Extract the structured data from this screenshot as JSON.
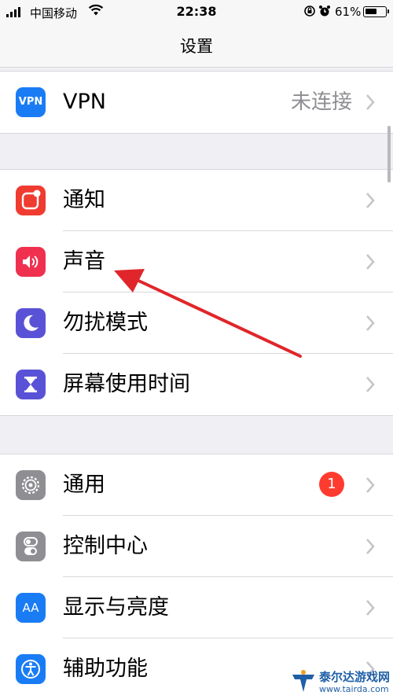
{
  "status_bar": {
    "carrier": "中国移动",
    "time": "22:38",
    "battery_percent": "61%",
    "battery_level": 0.61
  },
  "nav": {
    "title": "设置"
  },
  "groups": [
    {
      "rows": [
        {
          "label": "VPN",
          "detail": "未连接",
          "icon": "vpn-icon",
          "icon_text": "VPN",
          "icon_color": "#1a7cf5"
        }
      ]
    },
    {
      "rows": [
        {
          "label": "通知",
          "icon": "notifications-icon",
          "icon_color": "#f03b30"
        },
        {
          "label": "声音",
          "icon": "sounds-icon",
          "icon_color": "#f0304f"
        },
        {
          "label": "勿扰模式",
          "icon": "do-not-disturb-icon",
          "icon_color": "#5a52d6"
        },
        {
          "label": "屏幕使用时间",
          "icon": "screen-time-icon",
          "icon_color": "#5a52d6"
        }
      ]
    },
    {
      "rows": [
        {
          "label": "通用",
          "badge": "1",
          "icon": "general-icon",
          "icon_color": "#8e8e93"
        },
        {
          "label": "控制中心",
          "icon": "control-center-icon",
          "icon_color": "#8e8e93"
        },
        {
          "label": "显示与亮度",
          "icon": "display-icon",
          "icon_text": "AA",
          "icon_color": "#1a7cf5"
        },
        {
          "label": "辅助功能",
          "icon": "accessibility-icon",
          "icon_color": "#1a7cf5"
        }
      ]
    }
  ],
  "annotation": {
    "color": "#e0262a"
  },
  "watermark": {
    "name": "泰尔达游戏网",
    "url": "www.tairda.com"
  }
}
